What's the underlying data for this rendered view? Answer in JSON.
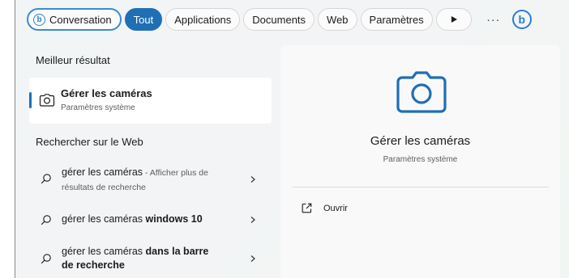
{
  "topbar": {
    "tabs": [
      {
        "label": "Conversation"
      },
      {
        "label": "Tout"
      },
      {
        "label": "Applications"
      },
      {
        "label": "Documents"
      },
      {
        "label": "Web"
      },
      {
        "label": "Paramètres"
      }
    ],
    "more_label": "···"
  },
  "left": {
    "best_heading": "Meilleur résultat",
    "best": {
      "title": "Gérer les caméras",
      "subtitle": "Paramètres système",
      "icon": "camera-icon"
    },
    "web_heading": "Rechercher sur le Web",
    "web_items": [
      {
        "text": "gérer les caméras",
        "suffix": " - Afficher plus de résultats de recherche"
      },
      {
        "text": "gérer les caméras ",
        "bold": "windows 10"
      },
      {
        "text": "gérer les caméras ",
        "bold": "dans la barre de recherche"
      }
    ]
  },
  "preview": {
    "title": "Gérer les caméras",
    "subtitle": "Paramètres système",
    "open_label": "Ouvrir",
    "icon": "camera-icon"
  },
  "colors": {
    "accent": "#1f6fb5",
    "bing": "#2a7bd6"
  }
}
